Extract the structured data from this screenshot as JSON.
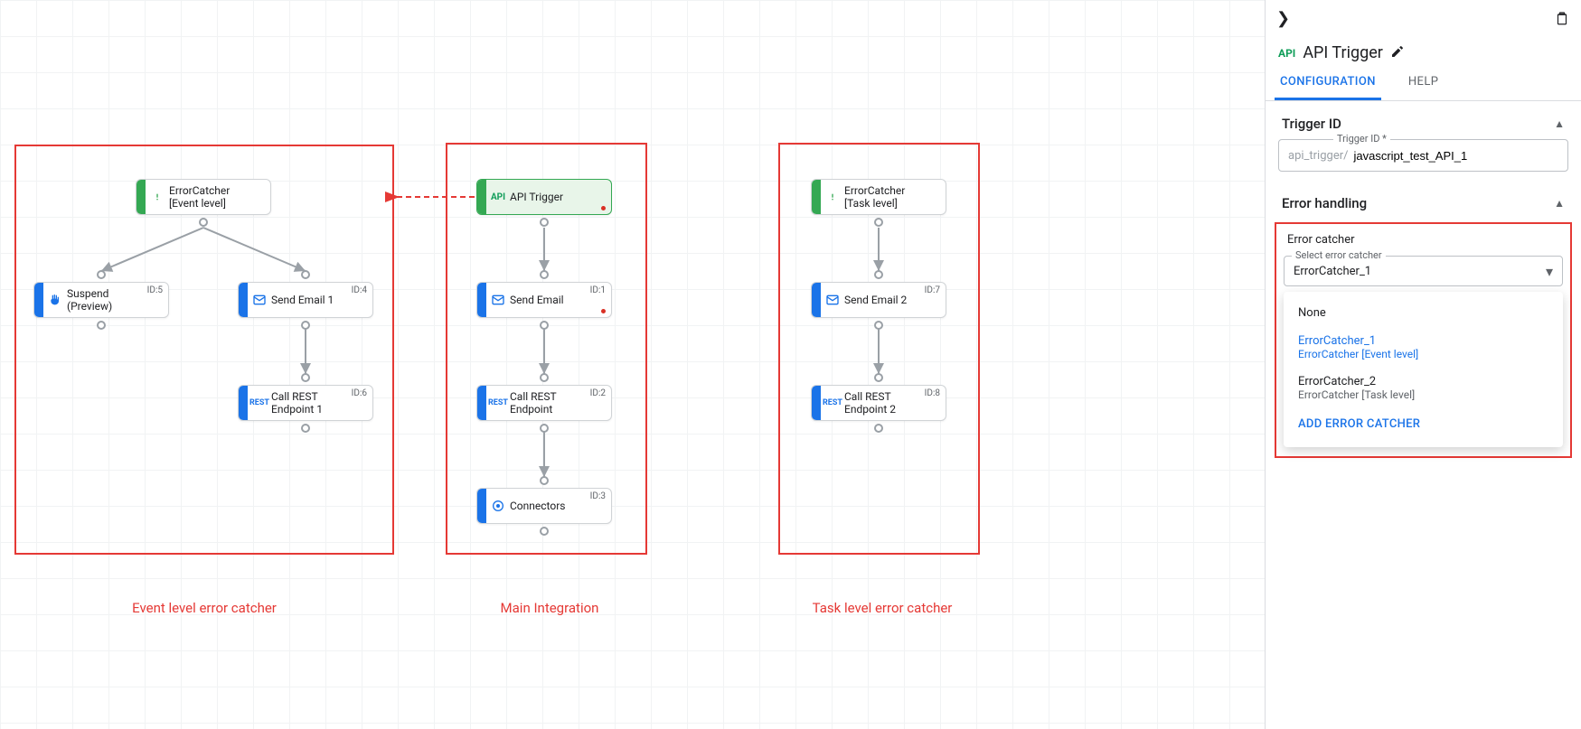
{
  "canvas": {
    "regions": {
      "event": {
        "caption": "Event level error catcher"
      },
      "main": {
        "caption": "Main Integration"
      },
      "task": {
        "caption": "Task level error catcher"
      }
    },
    "nodes": {
      "event_root": {
        "label": "ErrorCatcher\n[Event level]"
      },
      "suspend": {
        "label": "Suspend\n(Preview)",
        "id": "ID:5"
      },
      "send_email_1": {
        "label": "Send Email 1",
        "id": "ID:4"
      },
      "rest_1": {
        "label": "Call REST\nEndpoint 1",
        "id": "ID:6"
      },
      "api_trigger": {
        "label": "API Trigger"
      },
      "send_email": {
        "label": "Send Email",
        "id": "ID:1"
      },
      "rest": {
        "label": "Call REST\nEndpoint",
        "id": "ID:2"
      },
      "connectors": {
        "label": "Connectors",
        "id": "ID:3"
      },
      "task_root": {
        "label": "ErrorCatcher\n[Task level]"
      },
      "send_email_2": {
        "label": "Send Email 2",
        "id": "ID:7"
      },
      "rest_2": {
        "label": "Call REST\nEndpoint 2",
        "id": "ID:8"
      }
    }
  },
  "panel": {
    "api_badge": "API",
    "title": "API Trigger",
    "tabs": {
      "config": "CONFIGURATION",
      "help": "HELP"
    },
    "trigger_id_section": "Trigger ID",
    "trigger_id_label": "Trigger ID *",
    "trigger_id_prefix": "api_trigger/",
    "trigger_id_value": "javascript_test_API_1",
    "error_section": "Error handling",
    "error_catcher_label": "Error catcher",
    "select_label": "Select error catcher",
    "select_value": "ErrorCatcher_1",
    "options": [
      {
        "primary": "None",
        "secondary": ""
      },
      {
        "primary": "ErrorCatcher_1",
        "secondary": "ErrorCatcher [Event level]"
      },
      {
        "primary": "ErrorCatcher_2",
        "secondary": "ErrorCatcher [Task level]"
      }
    ],
    "add_label": "ADD ERROR CATCHER"
  }
}
